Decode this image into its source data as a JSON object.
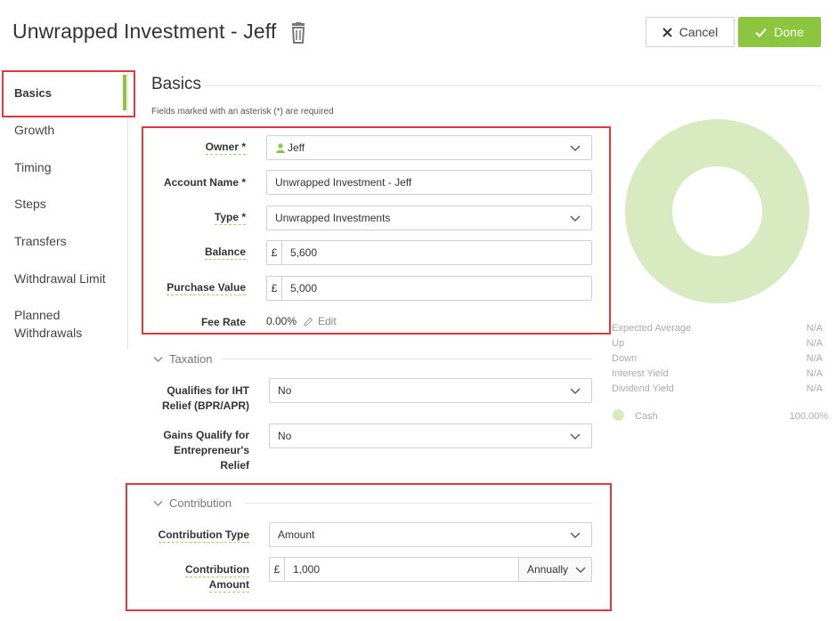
{
  "header": {
    "title": "Unwrapped Investment - Jeff",
    "cancel_label": "Cancel",
    "done_label": "Done"
  },
  "sidebar": {
    "items": [
      {
        "label": "Basics"
      },
      {
        "label": "Growth"
      },
      {
        "label": "Timing"
      },
      {
        "label": "Steps"
      },
      {
        "label": "Transfers"
      },
      {
        "label": "Withdrawal Limit"
      },
      {
        "label": "Planned"
      },
      {
        "label": "Withdrawals"
      }
    ]
  },
  "basics": {
    "title": "Basics",
    "required_note": "Fields marked with an asterisk (*) are required",
    "owner_label": "Owner *",
    "owner_value": "Jeff",
    "account_name_label": "Account Name *",
    "account_name_value": "Unwrapped Investment - Jeff",
    "type_label": "Type *",
    "type_value": "Unwrapped Investments",
    "balance_label": "Balance",
    "balance_currency": "£",
    "balance_value": "5,600",
    "purchase_label": "Purchase Value",
    "purchase_currency": "£",
    "purchase_value": "5,000",
    "fee_label": "Fee Rate",
    "fee_value": "0.00%",
    "fee_edit": "Edit"
  },
  "taxation": {
    "title": "Taxation",
    "iht_label_1": "Qualifies for IHT",
    "iht_label_2": "Relief (BPR/APR)",
    "iht_value": "No",
    "gains_label_1": "Gains Qualify for",
    "gains_label_2": "Entrepreneur's",
    "gains_label_3": "Relief",
    "gains_value": "No"
  },
  "contribution": {
    "title": "Contribution",
    "type_label": "Contribution Type",
    "type_value": "Amount",
    "amount_label_1": "Contribution",
    "amount_label_2": "Amount",
    "amount_currency": "£",
    "amount_value": "1,000",
    "frequency_value": "Annually"
  },
  "stats": {
    "expected_average_label": "Expected Average",
    "expected_average_value": "N/A",
    "up_label": "Up",
    "up_value": "N/A",
    "down_label": "Down",
    "down_value": "N/A",
    "interest_yield_label": "Interest Yield",
    "interest_yield_value": "N/A",
    "dividend_yield_label": "Dividend Yield",
    "dividend_yield_value": "N/A",
    "cash_label": "Cash",
    "cash_value": "100.00%"
  },
  "colors": {
    "accent": "#8cc63f",
    "donut": "#d8eac0",
    "highlight": "#e0383e"
  }
}
